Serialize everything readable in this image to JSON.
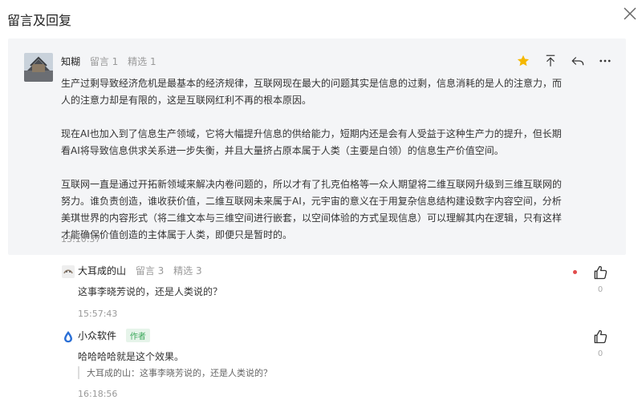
{
  "panel": {
    "title": "留言及回复"
  },
  "comment": {
    "author": "知糊",
    "comments_count": "留言 1",
    "featured_count": "精选 1",
    "paragraphs": [
      "生产过剩导致经济危机是最基本的经济规律，互联网现在最大的问题其实是信息的过剩，信息消耗的是人的注意力，而人的注意力却是有限的，这是互联网红利不再的根本原因。",
      "现在AI也加入到了信息生产领域，它将大幅提升信息的供给能力，短期内还是会有人受益于这种生产力的提升，但长期看AI将导致信息供求关系进一步失衡，并且大量挤占原本属于人类（主要是白领）的信息生产价值空间。",
      "互联网一直是通过开拓新领域来解决内卷问题的，所以才有了扎克伯格等一众人期望将二维互联网升级到三维互联网的努力。谁负责创造，谁收获价值，二维互联网未来属于AI，元宇宙的意义在于用复杂信息结构建设数字内容空间，分析美琪世界的内容形式（将二维文本与三维空间进行嵌套，以空间体验的方式呈现信息）可以理解其内在逻辑，只有这样才能确保价值创造的主体属于人类，即便只是暂时的。"
    ],
    "time": "13:10:37"
  },
  "replies": [
    {
      "author": "大耳成的山",
      "comments_count": "留言 3",
      "featured_count": "精选 3",
      "text": "这事李晓芳说的，还是人类说的？",
      "time": "15:57:43",
      "likes": "0"
    },
    {
      "author": "小众软件",
      "badge": "作者",
      "text": "哈哈哈哈就是这个效果。",
      "quote": "大耳成的山：这事李晓芳说的，还是人类说的？",
      "time": "16:18:56",
      "likes": "0"
    }
  ],
  "colors": {
    "star": "#f5b800",
    "red_dot": "#e24c4c",
    "author_badge": "#3aa75a"
  }
}
